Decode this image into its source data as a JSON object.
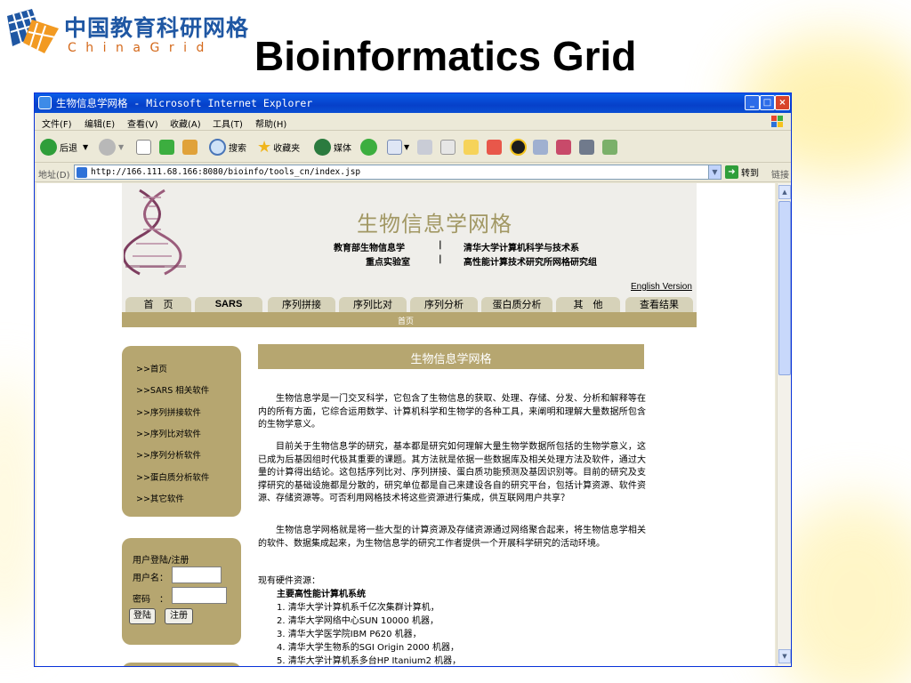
{
  "slide": {
    "title": "Bioinformatics Grid",
    "logo": {
      "chinese": "中国教育科研网格",
      "english": "ChinaGrid"
    }
  },
  "browser": {
    "window_title": "生物信息学网格 - Microsoft Internet Explorer",
    "menu": [
      "文件(F)",
      "编辑(E)",
      "查看(V)",
      "收藏(A)",
      "工具(T)",
      "帮助(H)"
    ],
    "toolbar": {
      "back": "后退",
      "search": "搜索",
      "favorites": "收藏夹",
      "media": "媒体"
    },
    "address_label": "地址(D)",
    "url": "http://166.111.68.166:8080/bioinfo/tools_cn/index.jsp",
    "go_label": "转到",
    "links_label": "链接"
  },
  "site": {
    "title": "生物信息学网格",
    "org_left_1": "教育部生物信息学",
    "org_left_2": "重点实验室",
    "separator": "|",
    "org_right_1": "清华大学计算机科学与技术系",
    "org_right_2": "高性能计算技术研究所网格研究组",
    "english_link": "English Version",
    "nav": [
      "首　页",
      "SARS",
      "序列拼接",
      "序列比对",
      "序列分析",
      "蛋白质分析",
      "其　他",
      "查看结果"
    ],
    "breadcrumb": "首页"
  },
  "sidebar": {
    "links": [
      ">>首页",
      ">>SARS 相关软件",
      ">>序列拼接软件",
      ">>序列比对软件",
      ">>序列分析软件",
      ">>蛋白质分析软件",
      ">>其它软件"
    ]
  },
  "login": {
    "title": "用户登陆/注册",
    "username_label": "用户名：",
    "password_label": "密码　：",
    "login_button": "登陆",
    "register_button": "注册"
  },
  "content": {
    "heading": "生物信息学网格",
    "paragraphs": [
      "生物信息学是一门交叉科学，它包含了生物信息的获取、处理、存储、分发、分析和解释等在内的所有方面，它综合运用数学、计算机科学和生物学的各种工具，来阐明和理解大量数据所包含的生物学意义。",
      "目前关于生物信息学的研究，基本都是研究如何理解大量生物学数据所包括的生物学意义，这已成为后基因组时代极其重要的课题。其方法就是依据一些数据库及相关处理方法及软件，通过大量的计算得出结论。这包括序列比对、序列拼接、蛋白质功能预测及基因识别等。目前的研究及支撑研究的基础设施都是分散的，研究单位都是自己来建设各自的研究平台，包括计算资源、软件资源、存储资源等。可否利用网格技术将这些资源进行集成，供互联网用户共享？",
      "生物信息学网格就是将一些大型的计算资源及存储资源通过网络聚合起来，将生物信息学相关的软件、数据集成起来，为生物信息学的研究工作者提供一个开展科学研究的活动环境。"
    ],
    "hardware_label": "现有硬件资源：",
    "hardware_subtitle": "主要高性能计算机系统",
    "hardware_items": [
      "1. 清华大学计算机系千亿次集群计算机，",
      "2. 清华大学网络中心SUN 10000 机器，",
      "3. 清华大学医学院IBM P620 机器，",
      "4. 清华大学生物系的SGI Origin 2000 机器，",
      "5. 清华大学计算机系多台HP Itanium2 机器，"
    ]
  }
}
